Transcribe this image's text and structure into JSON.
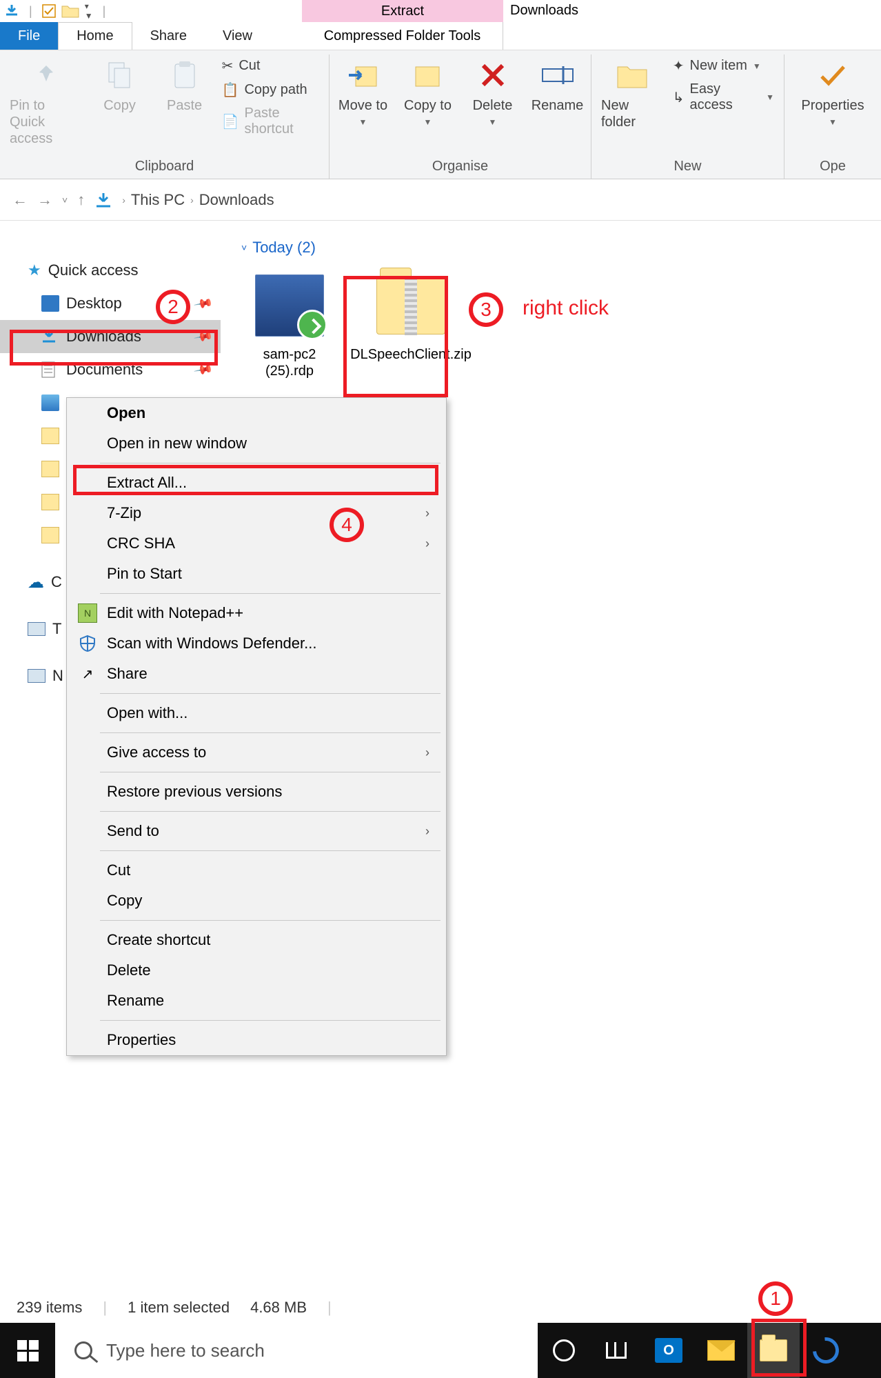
{
  "window": {
    "title": "Downloads"
  },
  "context_tab": {
    "title": "Extract",
    "sub": "Compressed Folder Tools"
  },
  "ribbon_tabs": {
    "file": "File",
    "home": "Home",
    "share": "Share",
    "view": "View"
  },
  "ribbon": {
    "clipboard": {
      "label": "Clipboard",
      "pin": "Pin to Quick access",
      "copy": "Copy",
      "paste": "Paste",
      "cut": "Cut",
      "copy_path": "Copy path",
      "paste_shortcut": "Paste shortcut"
    },
    "organise": {
      "label": "Organise",
      "move_to": "Move to",
      "copy_to": "Copy to",
      "delete": "Delete",
      "rename": "Rename"
    },
    "new": {
      "label": "New",
      "new_folder": "New folder",
      "new_item": "New item",
      "easy_access": "Easy access"
    },
    "open": {
      "label": "Ope",
      "properties": "Properties"
    }
  },
  "breadcrumb": {
    "root": "This PC",
    "child": "Downloads"
  },
  "nav": {
    "quick_access": "Quick access",
    "desktop": "Desktop",
    "downloads": "Downloads",
    "documents": "Documents",
    "onedrive_initial": "C",
    "this_pc_initial": "T",
    "network_initial": "N"
  },
  "content": {
    "group": "Today (2)",
    "files": [
      {
        "name": "sam-pc2 (25).rdp"
      },
      {
        "name": "DLSpeechClient.zip"
      }
    ]
  },
  "context_menu": {
    "open": "Open",
    "open_new": "Open in new window",
    "extract_all": "Extract All...",
    "seven_zip": "7-Zip",
    "crc": "CRC SHA",
    "pin_start": "Pin to Start",
    "notepadpp": "Edit with Notepad++",
    "defender": "Scan with Windows Defender...",
    "share": "Share",
    "open_with": "Open with...",
    "give_access": "Give access to",
    "restore": "Restore previous versions",
    "send_to": "Send to",
    "cut": "Cut",
    "copy": "Copy",
    "shortcut": "Create shortcut",
    "delete": "Delete",
    "rename": "Rename",
    "properties": "Properties"
  },
  "annotations": {
    "one": "1",
    "two": "2",
    "three": "3",
    "four": "4",
    "right_click": "right click"
  },
  "status": {
    "items": "239 items",
    "selected": "1 item selected",
    "size": "4.68 MB"
  },
  "taskbar": {
    "search_placeholder": "Type here to search"
  }
}
